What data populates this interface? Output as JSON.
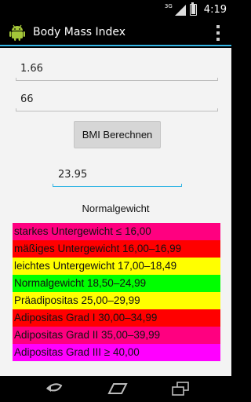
{
  "status_bar": {
    "network_type": "3G",
    "time": "4:19",
    "battery_level": 0.9
  },
  "action_bar": {
    "title": "Body Mass Index",
    "icon": "android-icon"
  },
  "form": {
    "height_value": "1.66",
    "weight_value": "66",
    "calculate_label": "BMI Berechnen",
    "result_value": "23.95",
    "category_text": "Normalgewicht"
  },
  "bmi_table": [
    {
      "label": "starkes Untergewicht ≤ 16,00",
      "color": "#ff0080"
    },
    {
      "label": "mäßiges Untergewicht 16,00–16,99",
      "color": "#ff0000"
    },
    {
      "label": "leichtes Untergewicht 17,00–18,49",
      "color": "#ffff00"
    },
    {
      "label": "Normalgewicht  18,50–24,99",
      "color": "#00ff00"
    },
    {
      "label": "Präadipositas 25,00–29,99",
      "color": "#ffff00"
    },
    {
      "label": "Adipositas Grad I 30,00–34,99",
      "color": "#ff0000"
    },
    {
      "label": "Adipositas Grad II 35,00–39,99",
      "color": "#ff0080"
    },
    {
      "label": "Adipositas Grad III ≥ 40,00",
      "color": "#ff00ff"
    }
  ],
  "colors": {
    "accent": "#33b5e5",
    "background": "#f3f3f3"
  }
}
